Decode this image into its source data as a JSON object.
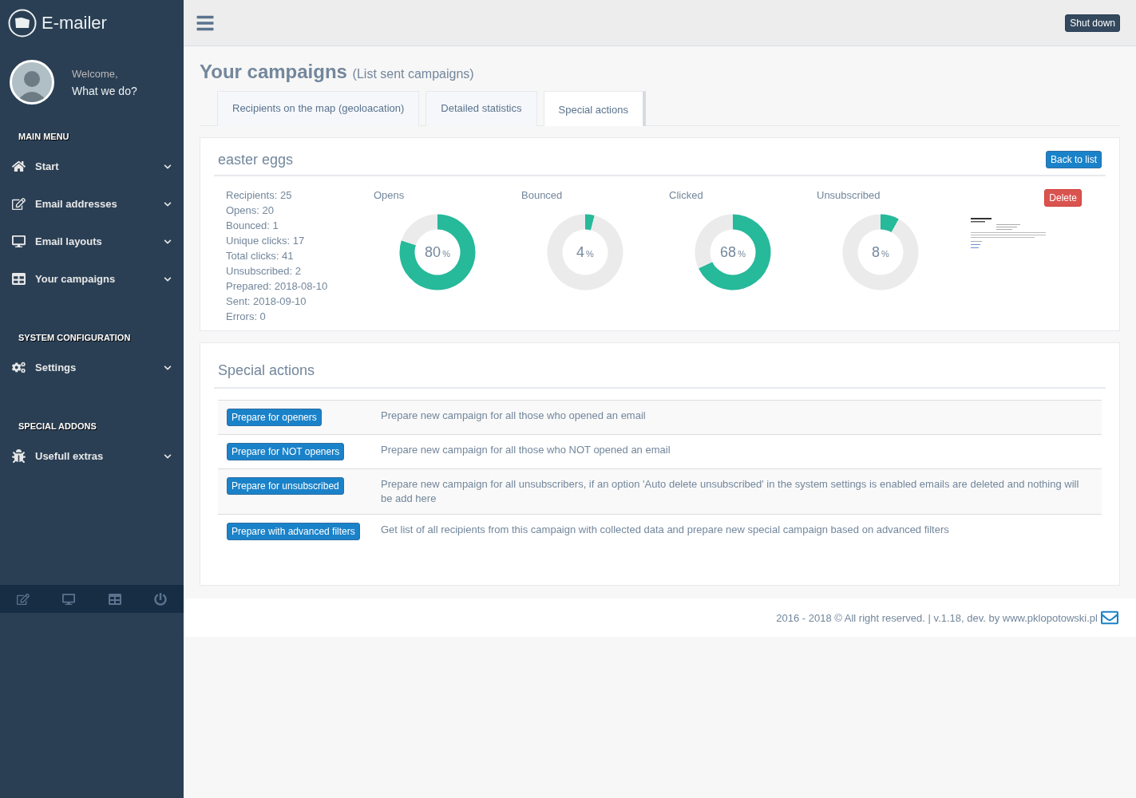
{
  "brand": {
    "name": "E-mailer"
  },
  "profile": {
    "greeting": "Welcome,",
    "subtitle": "What we do?"
  },
  "sidebar": {
    "sections": [
      {
        "title": "MAIN MENU",
        "items": [
          {
            "label": "Start"
          },
          {
            "label": "Email addresses"
          },
          {
            "label": "Email layouts"
          },
          {
            "label": "Your campaigns"
          }
        ]
      },
      {
        "title": "SYSTEM CONFIGURATION",
        "items": [
          {
            "label": "Settings"
          }
        ]
      },
      {
        "title": "SPECIAL ADDONS",
        "items": [
          {
            "label": "Usefull extras"
          }
        ]
      }
    ]
  },
  "topbar": {
    "button": "Shut down"
  },
  "page": {
    "title": "Your campaigns",
    "subtitle": "(List sent campaigns)"
  },
  "tabs": [
    {
      "label": "Recipients on the map (geoloacation)",
      "selected": false
    },
    {
      "label": "Detailed statistics",
      "selected": false
    },
    {
      "label": "Special actions",
      "selected": true
    }
  ],
  "campaign": {
    "name": "easter eggs",
    "back_button": "Back to list",
    "delete_button": "Delete",
    "stats": [
      "Recipients: 25",
      "Opens: 20",
      "Bounced: 1",
      "Unique clicks: 17",
      "Total clicks: 41",
      "Unsubscribed: 2",
      "Prepared: 2018-08-10",
      "Sent: 2018-09-10",
      "Errors: 0"
    ],
    "gauges": [
      {
        "value": "80",
        "unit": "%",
        "chart_data": {
          "type": "donut",
          "title": "Opens",
          "values": [
            80,
            20
          ]
        }
      },
      {
        "value": "4",
        "unit": "%",
        "chart_data": {
          "type": "donut",
          "title": "Bounced",
          "values": [
            4,
            96
          ]
        }
      },
      {
        "value": "68",
        "unit": "%",
        "chart_data": {
          "type": "donut",
          "title": "Clicked",
          "values": [
            68,
            32
          ]
        }
      },
      {
        "value": "8",
        "unit": "%",
        "chart_data": {
          "type": "donut",
          "title": "Unsubscribed",
          "values": [
            8,
            92
          ]
        }
      }
    ]
  },
  "special_actions": {
    "title": "Special actions",
    "rows": [
      {
        "button": "Prepare for openers",
        "description": "Prepare new campaign for all those who opened an email"
      },
      {
        "button": "Prepare for NOT openers",
        "description": "Prepare new campaign for all those who NOT opened an email"
      },
      {
        "button": "Prepare for unsubscribed",
        "description": "Prepare new campaign for all unsubscribers, if an option 'Auto delete unsubscribed' in the system settings is enabled emails are deleted and nothing will be add here"
      },
      {
        "button": "Prepare with advanced filters",
        "description": "Get list of all recipients from this campaign with collected data and prepare new special campaign based on advanced filters"
      }
    ]
  },
  "footer": {
    "text": "2016 - 2018 © All right reserved. | v.1.18, dev. by www.pklopotowski.pl"
  }
}
